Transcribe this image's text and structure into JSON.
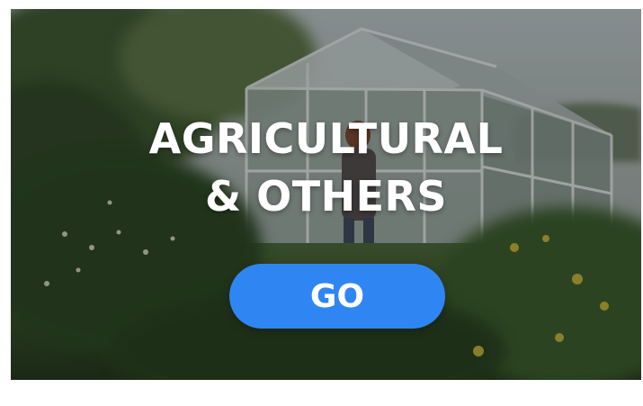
{
  "card": {
    "headline_line1": "AGRICULTURAL",
    "headline_line2": "& OTHERS",
    "button_label": "GO"
  },
  "colors": {
    "button_background": "#2f86f2",
    "text": "#ffffff"
  }
}
